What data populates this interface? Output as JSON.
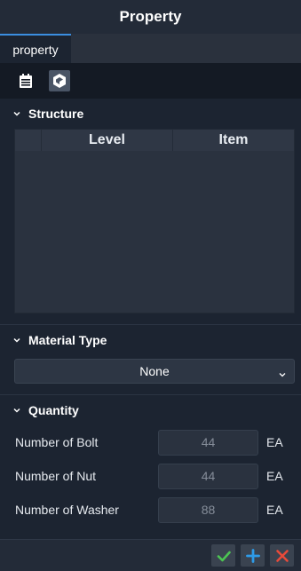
{
  "title": "Property",
  "tabs": [
    {
      "label": "property"
    }
  ],
  "toolbar": {
    "icons": [
      "calendar-icon",
      "settings-logo-icon"
    ]
  },
  "structure": {
    "heading": "Structure",
    "columns": [
      "",
      "Level",
      "Item"
    ],
    "rows": []
  },
  "material": {
    "heading": "Material Type",
    "selected": "None"
  },
  "quantity": {
    "heading": "Quantity",
    "rows": [
      {
        "label": "Number of Bolt",
        "value": "44",
        "unit": "EA"
      },
      {
        "label": "Number of Nut",
        "value": "44",
        "unit": "EA"
      },
      {
        "label": "Number of Washer",
        "value": "88",
        "unit": "EA"
      }
    ]
  },
  "colors": {
    "accent": "#3b8ee0",
    "confirm": "#4cc552",
    "add": "#2e9be8",
    "cancel": "#e84a3a"
  }
}
